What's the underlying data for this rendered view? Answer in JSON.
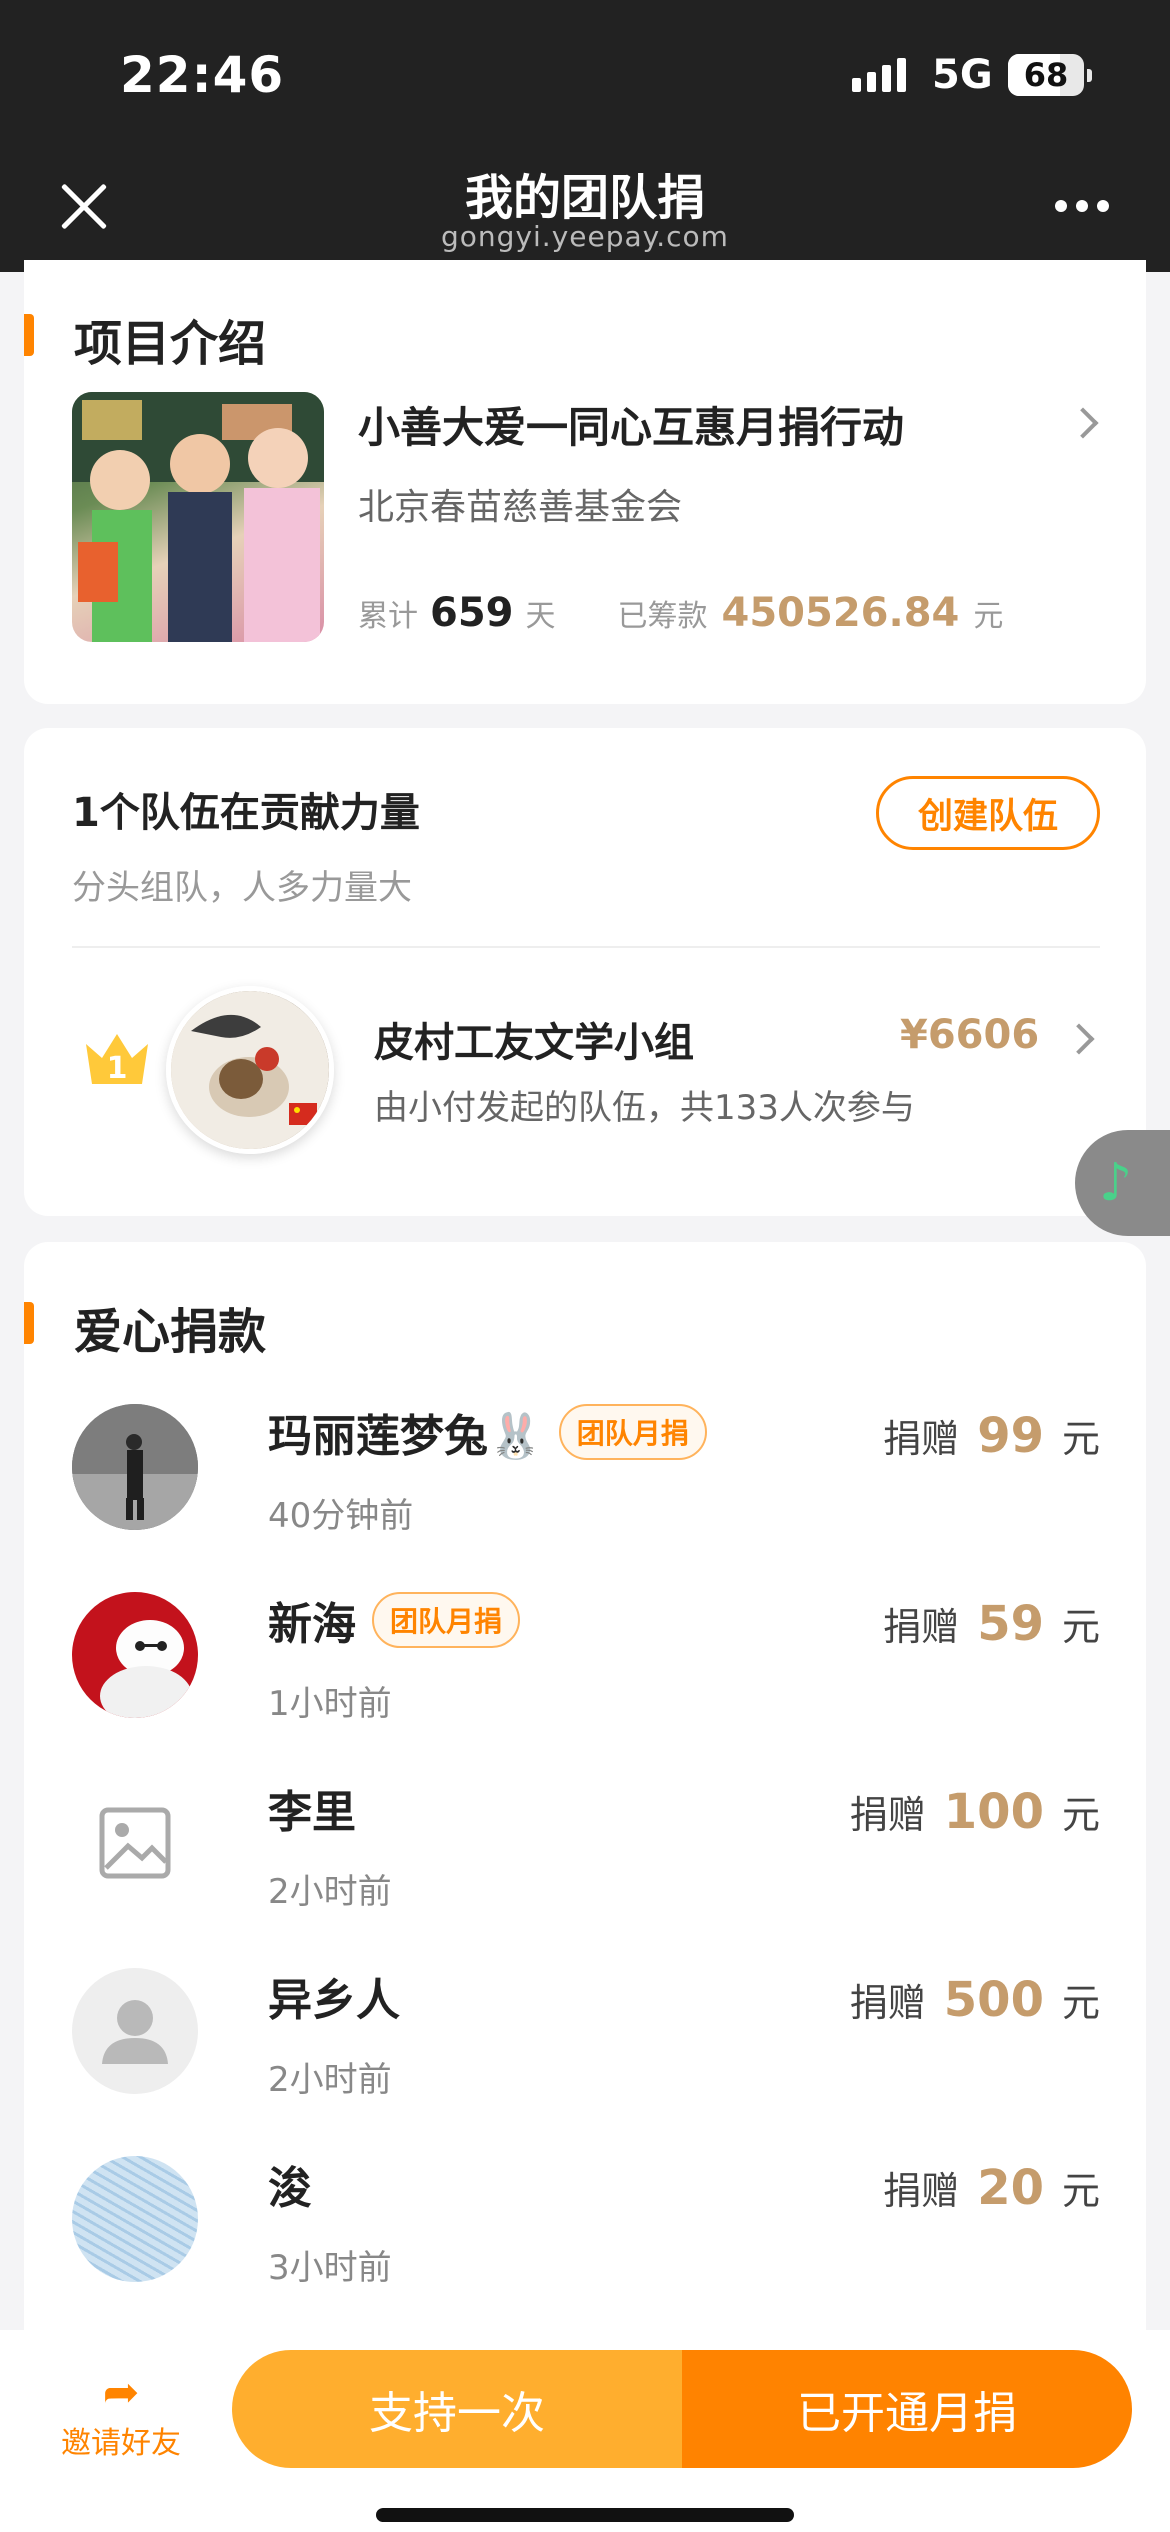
{
  "status_bar": {
    "time": "22:46",
    "network": "5G",
    "battery": "68"
  },
  "nav": {
    "title": "我的团队捐",
    "subtitle": "gongyi.yeepay.com"
  },
  "project": {
    "section_title": "项目介绍",
    "name": "小善大爱一同心互惠月捐行动",
    "org": "北京春苗慈善基金会",
    "days_label": "累计",
    "days": "659",
    "days_unit": "天",
    "raised_label": "已筹款",
    "raised": "450526.84",
    "raised_unit": "元"
  },
  "teams": {
    "title": "1个队伍在贡献力量",
    "subtitle": "分头组队，人多力量大",
    "create_label": "创建队伍",
    "top_team": {
      "rank": "1",
      "name": "皮村工友文学小组",
      "desc": "由小付发起的队伍，共133人次参与",
      "amount": "¥6606"
    }
  },
  "donations": {
    "section_title": "爱心捐款",
    "donate_label": "捐赠",
    "unit": "元",
    "items": [
      {
        "name": "玛丽莲梦兔🐰",
        "badge": "团队月捐",
        "time": "40分钟前",
        "amount": "99"
      },
      {
        "name": "新海",
        "badge": "团队月捐",
        "time": "1小时前",
        "amount": "59"
      },
      {
        "name": "李里",
        "badge": "",
        "time": "2小时前",
        "amount": "100"
      },
      {
        "name": "异乡人",
        "badge": "",
        "time": "2小时前",
        "amount": "500"
      },
      {
        "name": "浚",
        "badge": "",
        "time": "3小时前",
        "amount": "20"
      }
    ]
  },
  "bottom": {
    "invite_label": "邀请好友",
    "once_label": "支持一次",
    "monthly_label": "已开通月捐"
  },
  "colors": {
    "accent": "#ff8400",
    "gold": "#c59c6c",
    "dark": "#222222"
  }
}
